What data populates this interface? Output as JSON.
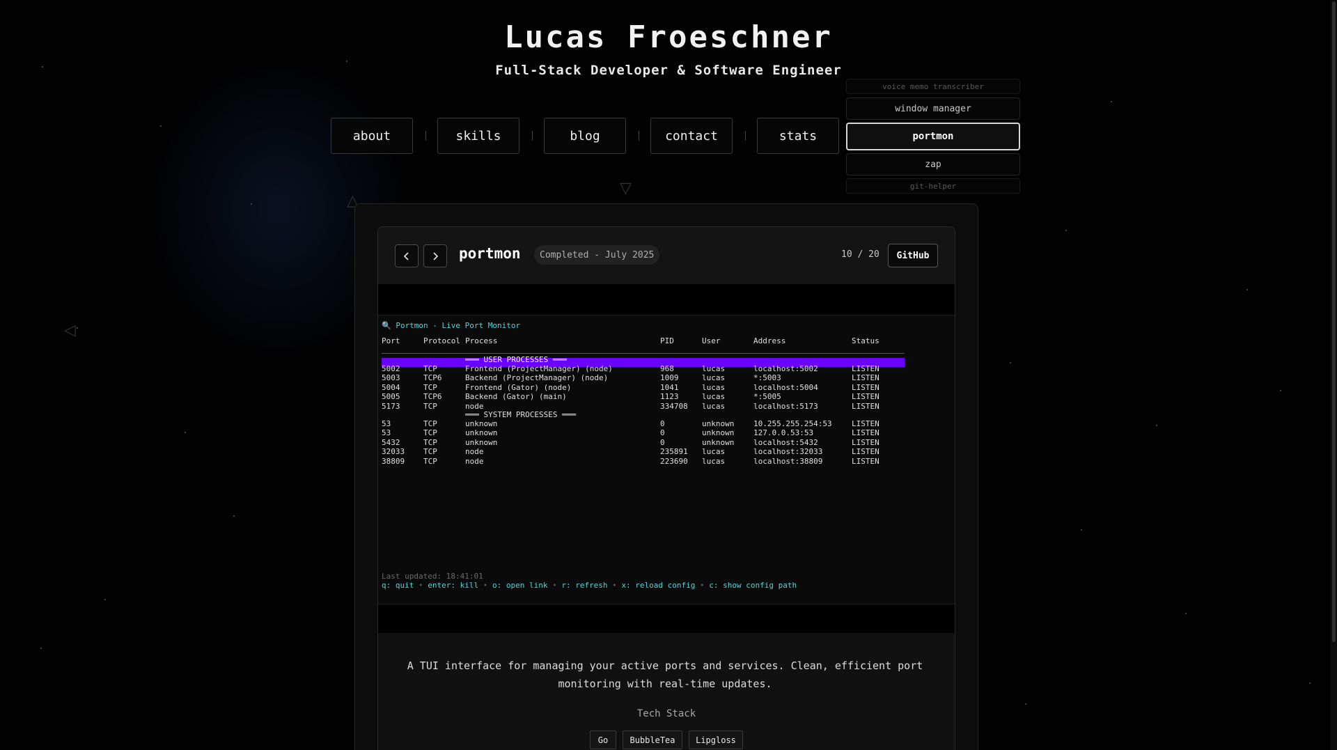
{
  "header": {
    "title": "Lucas Froeschner",
    "subtitle": "Full-Stack Developer & Software Engineer"
  },
  "nav": [
    "about",
    "skills",
    "blog",
    "contact",
    "stats"
  ],
  "projects_carousel": {
    "items": [
      "voice memo transcriber",
      "window manager",
      "portmon",
      "zap",
      "git-helper"
    ],
    "active": "portmon"
  },
  "project": {
    "name": "portmon",
    "status": "Completed - July 2025",
    "counter": "10 / 20",
    "github_label": "GitHub",
    "description": "A TUI interface for managing your active ports and services. Clean, efficient port monitoring with real-time updates.",
    "tech_stack_label": "Tech Stack",
    "tech_stack": [
      "Go",
      "BubbleTea",
      "Lipgloss"
    ]
  },
  "terminal": {
    "title": "🔍 Portmon - Live Port Monitor",
    "columns": [
      "Port",
      "Protocol",
      "Process",
      "PID",
      "User",
      "Address",
      "Status"
    ],
    "user_section": "═══ USER PROCESSES ═══",
    "user_rows": [
      [
        "5002",
        "TCP",
        "Frontend (ProjectManager) (node)",
        "968",
        "lucas",
        "localhost:5002",
        "LISTEN"
      ],
      [
        "5003",
        "TCP6",
        "Backend (ProjectManager) (node)",
        "1009",
        "lucas",
        "*:5003",
        "LISTEN"
      ],
      [
        "5004",
        "TCP",
        "Frontend (Gator) (node)",
        "1041",
        "lucas",
        "localhost:5004",
        "LISTEN"
      ],
      [
        "5005",
        "TCP6",
        "Backend (Gator) (main)",
        "1123",
        "lucas",
        "*:5005",
        "LISTEN"
      ],
      [
        "5173",
        "TCP",
        "node",
        "334708",
        "lucas",
        "localhost:5173",
        "LISTEN"
      ]
    ],
    "system_section": "═══ SYSTEM PROCESSES ═══",
    "system_rows": [
      [
        "53",
        "TCP",
        "unknown",
        "0",
        "unknown",
        "10.255.255.254:53",
        "LISTEN"
      ],
      [
        "53",
        "TCP",
        "unknown",
        "0",
        "unknown",
        "127.0.0.53:53",
        "LISTEN"
      ],
      [
        "5432",
        "TCP",
        "unknown",
        "0",
        "unknown",
        "localhost:5432",
        "LISTEN"
      ],
      [
        "32033",
        "TCP",
        "node",
        "235891",
        "lucas",
        "localhost:32033",
        "LISTEN"
      ],
      [
        "38809",
        "TCP",
        "node",
        "223690",
        "lucas",
        "localhost:38809",
        "LISTEN"
      ]
    ],
    "last_updated": "Last updated: 18:41:01",
    "help": [
      {
        "key": "q:",
        "action": "quit"
      },
      {
        "key": "enter:",
        "action": "kill"
      },
      {
        "key": "o:",
        "action": "open link"
      },
      {
        "key": "r:",
        "action": "refresh"
      },
      {
        "key": "x:",
        "action": "reload config"
      },
      {
        "key": "c:",
        "action": "show config path"
      }
    ],
    "separator": "•"
  },
  "colors": {
    "background": "#020203",
    "accent_cyan": "#56d4d8",
    "user_bar": "#6a00ff"
  },
  "icons": {
    "prev": "chevron-left-icon",
    "next": "chevron-right-icon"
  }
}
